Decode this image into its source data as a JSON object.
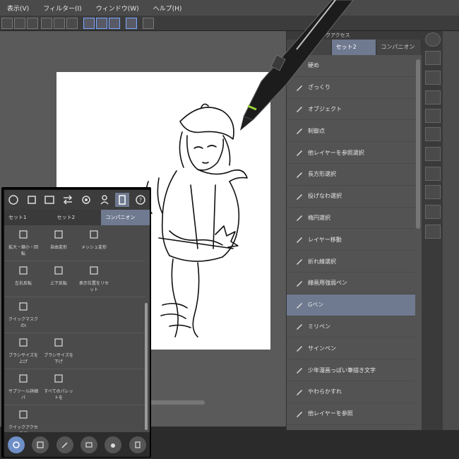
{
  "menu": {
    "items": [
      "表示(V)",
      "フィルター(I)",
      "ウィンドウ(W)",
      "ヘルプ(H)"
    ]
  },
  "quick_access": {
    "header": "クイックアクセス",
    "tabs": [
      "",
      "セット2",
      "コンパニオン"
    ],
    "selected_tab": 1,
    "items": [
      {
        "label": "硬め",
        "icon": "brush-icon"
      },
      {
        "label": "ざっくり",
        "icon": "brush-icon"
      },
      {
        "label": "オブジェクト",
        "icon": "object-select-icon"
      },
      {
        "label": "制御点",
        "icon": "control-point-icon"
      },
      {
        "label": "他レイヤーを参照選択",
        "icon": "sparkle-icon"
      },
      {
        "label": "長方形選択",
        "icon": "rect-select-icon"
      },
      {
        "label": "投げなわ選択",
        "icon": "lasso-icon"
      },
      {
        "label": "楕円選択",
        "icon": "ellipse-select-icon"
      },
      {
        "label": "レイヤー移動",
        "icon": "move-icon"
      },
      {
        "label": "折れ線選択",
        "icon": "polyline-select-icon"
      },
      {
        "label": "線画用強弱ペン",
        "icon": "pen-icon"
      },
      {
        "label": "Gペン",
        "icon": "pen-icon"
      },
      {
        "label": "ミリペン",
        "icon": "pen-icon"
      },
      {
        "label": "サインペン",
        "icon": "pen-icon"
      },
      {
        "label": "少年漫画っぽい筆描き文字",
        "icon": "pen-icon"
      },
      {
        "label": "やわらかすれ",
        "icon": "pen-icon"
      },
      {
        "label": "他レイヤーを参照",
        "icon": "fill-icon"
      }
    ],
    "selected_item": 11
  },
  "companion": {
    "tabs": [
      "セット1",
      "セット2",
      "コンパニオン"
    ],
    "selected_tab": 2,
    "rows": [
      [
        "拡大・縮小・回転",
        "自由変形",
        "メッシュ変形"
      ],
      [
        "左右反転",
        "上下反転",
        "表示位置をリセット"
      ],
      [
        "クイックマスクのI"
      ],
      [
        "ブラシサイズを上げ",
        "ブラシサイズを下げ"
      ],
      [
        "サブツール詳細パ",
        "すべてのパレットを"
      ],
      [
        "クイックアクセスに"
      ]
    ]
  },
  "colors": {
    "accent": "#6f7a90",
    "panel": "#535353"
  }
}
